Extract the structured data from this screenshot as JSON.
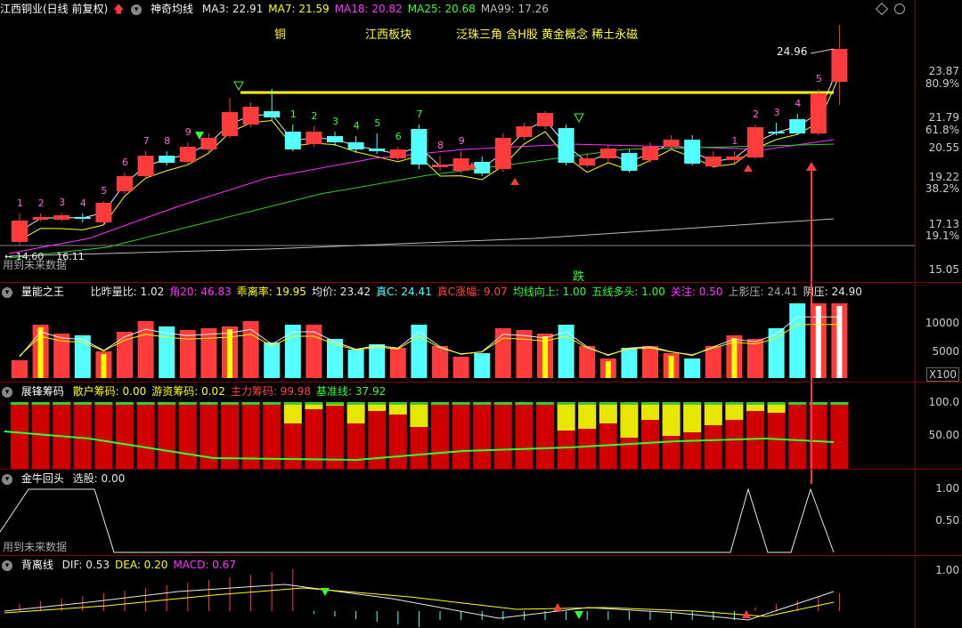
{
  "colors": {
    "up": "#ff3b3b",
    "down": "#54ffff",
    "yellow": "#ffff00",
    "magenta": "#ff33ff",
    "green": "#33cc33",
    "white": "#e8e8e8"
  },
  "main": {
    "stock": "江西铜业(日线 前复权)",
    "indicator": "神奇均线",
    "ma": [
      {
        "label": "MA3: 22.91",
        "color": "#e8e8e8"
      },
      {
        "label": "MA7: 21.59",
        "color": "#ffff00"
      },
      {
        "label": "MA18: 20.82",
        "color": "#ff33ff"
      },
      {
        "label": "MA25: 20.68",
        "color": "#33ff33"
      },
      {
        "label": "MA99: 17.26",
        "color": "#bbbbbb"
      }
    ],
    "tags": [
      "铜",
      "江西板块",
      "泛珠三角 含H股 黄金概念 稀土永磁"
    ],
    "price_axis": [
      "23.87",
      "80.9%",
      "21.79",
      "61.8%",
      "20.55",
      "19.22",
      "38.2%",
      "17.13",
      "19.1%",
      "15.05"
    ],
    "high_label": "24.96",
    "low_label": "← 14.60",
    "low_label2": "16.11",
    "watermark": "用到未来数据",
    "die_label": "跌",
    "wave_labels": [
      "1",
      "2",
      "3",
      "4",
      "5",
      "6",
      "7",
      "8",
      "9",
      "1",
      "2",
      "3",
      "4",
      "5",
      "6",
      "7",
      "8",
      "9",
      "1",
      "2",
      "3",
      "4",
      "5"
    ]
  },
  "volume": {
    "title": "量能之王",
    "fields": [
      {
        "label": "比昨量比: 1.02",
        "color": "#e8e8e8"
      },
      {
        "label": "角20: 46.83",
        "color": "#ff33ff"
      },
      {
        "label": "乖离率: 19.95",
        "color": "#ffff00"
      },
      {
        "label": "均价: 23.42",
        "color": "#e8e8e8"
      },
      {
        "label": "真C: 24.41",
        "color": "#54ffff"
      },
      {
        "label": "真C涨幅: 9.07",
        "color": "#ff4444"
      },
      {
        "label": "均线向上: 1.00",
        "color": "#33ff33"
      },
      {
        "label": "五线多头: 1.00",
        "color": "#33ff33"
      },
      {
        "label": "关注: 0.50",
        "color": "#ff33ff"
      },
      {
        "label": "上影压: 24.41",
        "color": "#aaaaaa"
      },
      {
        "label": "阴压: 24.90",
        "color": "#e8e8e8"
      }
    ],
    "axis": [
      "10000",
      "5000",
      "X100"
    ]
  },
  "chips": {
    "title": "展锋筹码",
    "fields": [
      {
        "label": "散户筹码: 0.00",
        "color": "#ffff00"
      },
      {
        "label": "游资筹码: 0.02",
        "color": "#ffff00"
      },
      {
        "label": "主力筹码: 99.98",
        "color": "#ff4444"
      },
      {
        "label": "基准线: 37.92",
        "color": "#33ff33"
      }
    ],
    "axis": [
      "100.0",
      "50.00"
    ]
  },
  "bull": {
    "title": "金牛回头",
    "fields": [
      {
        "label": "选股: 0.00",
        "color": "#e8e8e8"
      }
    ],
    "axis": [
      "1.00",
      "0.50"
    ],
    "watermark": "用到未来数据"
  },
  "macd": {
    "title": "背离线",
    "fields": [
      {
        "label": "DIF: 0.53",
        "color": "#e8e8e8"
      },
      {
        "label": "DEA: 0.20",
        "color": "#ffff00"
      },
      {
        "label": "MACD: 0.67",
        "color": "#ff33ff"
      }
    ],
    "axis": [
      "1.00"
    ]
  },
  "icons": [
    "up-arrow-icon",
    "circle-menu-icon",
    "diamond-icon",
    "settings-icon"
  ]
}
